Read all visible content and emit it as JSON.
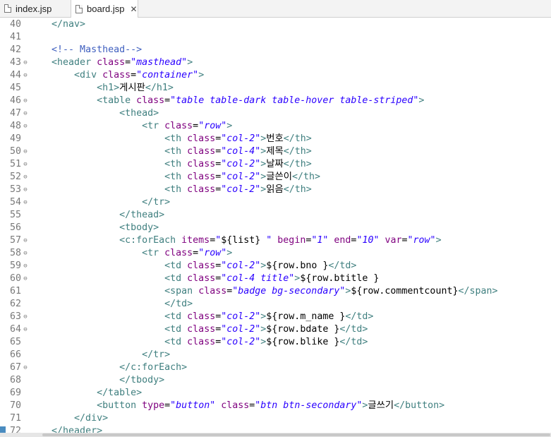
{
  "tabs": [
    {
      "label": "index.jsp",
      "active": false
    },
    {
      "label": "board.jsp",
      "active": true,
      "close": "✕"
    }
  ],
  "lines": [
    {
      "n": "40",
      "fold": "",
      "segs": [
        [
          "t",
          "    "
        ],
        [
          "tag",
          "</nav>"
        ]
      ]
    },
    {
      "n": "41",
      "fold": "",
      "segs": []
    },
    {
      "n": "42",
      "fold": "",
      "segs": [
        [
          "t",
          "    "
        ],
        [
          "com",
          "<!-- Masthead-->"
        ]
      ]
    },
    {
      "n": "43",
      "fold": "⊖",
      "segs": [
        [
          "t",
          "    "
        ],
        [
          "tag",
          "<header "
        ],
        [
          "attr",
          "class"
        ],
        [
          "t",
          "="
        ],
        [
          "val",
          "\"masthead\""
        ],
        [
          "tag",
          ">"
        ]
      ]
    },
    {
      "n": "44",
      "fold": "⊖",
      "segs": [
        [
          "t",
          "        "
        ],
        [
          "tag",
          "<div "
        ],
        [
          "attr",
          "class"
        ],
        [
          "t",
          "="
        ],
        [
          "val",
          "\"container\""
        ],
        [
          "tag",
          ">"
        ]
      ]
    },
    {
      "n": "45",
      "fold": "",
      "segs": [
        [
          "t",
          "            "
        ],
        [
          "tag",
          "<h1>"
        ],
        [
          "t",
          "게시판"
        ],
        [
          "tag",
          "</h1>"
        ]
      ]
    },
    {
      "n": "46",
      "fold": "⊖",
      "segs": [
        [
          "t",
          "            "
        ],
        [
          "tag",
          "<table "
        ],
        [
          "attr",
          "class"
        ],
        [
          "t",
          "="
        ],
        [
          "val",
          "\"table table-dark table-hover table-striped\""
        ],
        [
          "tag",
          ">"
        ]
      ]
    },
    {
      "n": "47",
      "fold": "⊖",
      "segs": [
        [
          "t",
          "                "
        ],
        [
          "tag",
          "<thead>"
        ]
      ]
    },
    {
      "n": "48",
      "fold": "⊖",
      "segs": [
        [
          "t",
          "                    "
        ],
        [
          "tag",
          "<tr "
        ],
        [
          "attr",
          "class"
        ],
        [
          "t",
          "="
        ],
        [
          "val",
          "\"row\""
        ],
        [
          "tag",
          ">"
        ]
      ]
    },
    {
      "n": "49",
      "fold": "",
      "segs": [
        [
          "t",
          "                        "
        ],
        [
          "tag",
          "<th "
        ],
        [
          "attr",
          "class"
        ],
        [
          "t",
          "="
        ],
        [
          "val",
          "\"col-2\""
        ],
        [
          "tag",
          ">"
        ],
        [
          "t",
          "번호"
        ],
        [
          "tag",
          "</th>"
        ]
      ]
    },
    {
      "n": "50",
      "fold": "⊖",
      "segs": [
        [
          "t",
          "                        "
        ],
        [
          "tag",
          "<th "
        ],
        [
          "attr",
          "class"
        ],
        [
          "t",
          "="
        ],
        [
          "val",
          "\"col-4\""
        ],
        [
          "tag",
          ">"
        ],
        [
          "t",
          "제목"
        ],
        [
          "tag",
          "</th>"
        ]
      ]
    },
    {
      "n": "51",
      "fold": "⊖",
      "segs": [
        [
          "t",
          "                        "
        ],
        [
          "tag",
          "<th "
        ],
        [
          "attr",
          "class"
        ],
        [
          "t",
          "="
        ],
        [
          "val",
          "\"col-2\""
        ],
        [
          "tag",
          ">"
        ],
        [
          "t",
          "날짜"
        ],
        [
          "tag",
          "</th>"
        ]
      ]
    },
    {
      "n": "52",
      "fold": "⊖",
      "segs": [
        [
          "t",
          "                        "
        ],
        [
          "tag",
          "<th "
        ],
        [
          "attr",
          "class"
        ],
        [
          "t",
          "="
        ],
        [
          "val",
          "\"col-2\""
        ],
        [
          "tag",
          ">"
        ],
        [
          "t",
          "글쓴이"
        ],
        [
          "tag",
          "</th>"
        ]
      ]
    },
    {
      "n": "53",
      "fold": "⊖",
      "segs": [
        [
          "t",
          "                        "
        ],
        [
          "tag",
          "<th "
        ],
        [
          "attr",
          "class"
        ],
        [
          "t",
          "="
        ],
        [
          "val",
          "\"col-2\""
        ],
        [
          "tag",
          ">"
        ],
        [
          "t",
          "읽음"
        ],
        [
          "tag",
          "</th>"
        ]
      ]
    },
    {
      "n": "54",
      "fold": "⊖",
      "segs": [
        [
          "t",
          "                    "
        ],
        [
          "tag",
          "</tr>"
        ]
      ]
    },
    {
      "n": "55",
      "fold": "",
      "segs": [
        [
          "t",
          "                "
        ],
        [
          "tag",
          "</thead>"
        ]
      ]
    },
    {
      "n": "56",
      "fold": "",
      "segs": [
        [
          "t",
          "                "
        ],
        [
          "tag",
          "<tbody>"
        ]
      ]
    },
    {
      "n": "57",
      "fold": "⊖",
      "segs": [
        [
          "t",
          "                "
        ],
        [
          "tag",
          "<c:forEach "
        ],
        [
          "attr",
          "items"
        ],
        [
          "t",
          "="
        ],
        [
          "val",
          "\""
        ],
        [
          "t",
          "${list}"
        ],
        [
          "val",
          " \""
        ],
        [
          "t",
          " "
        ],
        [
          "attr",
          "begin"
        ],
        [
          "t",
          "="
        ],
        [
          "val",
          "\"1\""
        ],
        [
          "t",
          " "
        ],
        [
          "attr",
          "end"
        ],
        [
          "t",
          "="
        ],
        [
          "val",
          "\"10\""
        ],
        [
          "t",
          " "
        ],
        [
          "attr",
          "var"
        ],
        [
          "t",
          "="
        ],
        [
          "val",
          "\"row\""
        ],
        [
          "tag",
          ">"
        ]
      ]
    },
    {
      "n": "58",
      "fold": "⊖",
      "segs": [
        [
          "t",
          "                    "
        ],
        [
          "tag",
          "<tr "
        ],
        [
          "attr",
          "class"
        ],
        [
          "t",
          "="
        ],
        [
          "val",
          "\"row\""
        ],
        [
          "tag",
          ">"
        ]
      ]
    },
    {
      "n": "59",
      "fold": "⊖",
      "segs": [
        [
          "t",
          "                        "
        ],
        [
          "tag",
          "<td "
        ],
        [
          "attr",
          "class"
        ],
        [
          "t",
          "="
        ],
        [
          "val",
          "\"col-2\""
        ],
        [
          "tag",
          ">"
        ],
        [
          "t",
          "${row.bno }"
        ],
        [
          "tag",
          "</td>"
        ]
      ]
    },
    {
      "n": "60",
      "fold": "⊖",
      "segs": [
        [
          "t",
          "                        "
        ],
        [
          "tag",
          "<td "
        ],
        [
          "attr",
          "class"
        ],
        [
          "t",
          "="
        ],
        [
          "val",
          "\"col-4 title\""
        ],
        [
          "tag",
          ">"
        ],
        [
          "t",
          "${row.btitle }"
        ]
      ]
    },
    {
      "n": "61",
      "fold": "",
      "segs": [
        [
          "t",
          "                        "
        ],
        [
          "tag",
          "<span "
        ],
        [
          "attr",
          "class"
        ],
        [
          "t",
          "="
        ],
        [
          "val",
          "\"badge bg-secondary\""
        ],
        [
          "tag",
          ">"
        ],
        [
          "t",
          "${row.commentcount}"
        ],
        [
          "tag",
          "</span>"
        ]
      ]
    },
    {
      "n": "62",
      "fold": "",
      "segs": [
        [
          "t",
          "                        "
        ],
        [
          "tag",
          "</td>"
        ]
      ]
    },
    {
      "n": "63",
      "fold": "⊖",
      "segs": [
        [
          "t",
          "                        "
        ],
        [
          "tag",
          "<td "
        ],
        [
          "attr",
          "class"
        ],
        [
          "t",
          "="
        ],
        [
          "val",
          "\"col-2\""
        ],
        [
          "tag",
          ">"
        ],
        [
          "t",
          "${row.m_name }"
        ],
        [
          "tag",
          "</td>"
        ]
      ]
    },
    {
      "n": "64",
      "fold": "⊖",
      "segs": [
        [
          "t",
          "                        "
        ],
        [
          "tag",
          "<td "
        ],
        [
          "attr",
          "class"
        ],
        [
          "t",
          "="
        ],
        [
          "val",
          "\"col-2\""
        ],
        [
          "tag",
          ">"
        ],
        [
          "t",
          "${row.bdate }"
        ],
        [
          "tag",
          "</td>"
        ]
      ]
    },
    {
      "n": "65",
      "fold": "",
      "segs": [
        [
          "t",
          "                        "
        ],
        [
          "tag",
          "<td "
        ],
        [
          "attr",
          "class"
        ],
        [
          "t",
          "="
        ],
        [
          "val",
          "\"col-2\""
        ],
        [
          "tag",
          ">"
        ],
        [
          "t",
          "${row.blike }"
        ],
        [
          "tag",
          "</td>"
        ]
      ]
    },
    {
      "n": "66",
      "fold": "",
      "segs": [
        [
          "t",
          "                    "
        ],
        [
          "tag",
          "</tr>"
        ]
      ]
    },
    {
      "n": "67",
      "fold": "⊖",
      "segs": [
        [
          "t",
          "                "
        ],
        [
          "tag",
          "</c:forEach>"
        ]
      ]
    },
    {
      "n": "68",
      "fold": "",
      "segs": [
        [
          "t",
          "                "
        ],
        [
          "tag",
          "</tbody>"
        ]
      ]
    },
    {
      "n": "69",
      "fold": "",
      "segs": [
        [
          "t",
          "            "
        ],
        [
          "tag",
          "</table>"
        ]
      ]
    },
    {
      "n": "70",
      "fold": "",
      "segs": [
        [
          "t",
          "            "
        ],
        [
          "tag",
          "<button "
        ],
        [
          "attr",
          "type"
        ],
        [
          "t",
          "="
        ],
        [
          "val",
          "\"button\""
        ],
        [
          "t",
          " "
        ],
        [
          "attr",
          "class"
        ],
        [
          "t",
          "="
        ],
        [
          "val",
          "\"btn btn-secondary\""
        ],
        [
          "tag",
          ">"
        ],
        [
          "t",
          "글쓰기"
        ],
        [
          "tag",
          "</button>"
        ]
      ]
    },
    {
      "n": "71",
      "fold": "",
      "segs": [
        [
          "t",
          "        "
        ],
        [
          "tag",
          "</div>"
        ]
      ]
    },
    {
      "n": "72",
      "fold": "",
      "segs": [
        [
          "t",
          "    "
        ],
        [
          "tag",
          "</header>"
        ]
      ]
    }
  ]
}
